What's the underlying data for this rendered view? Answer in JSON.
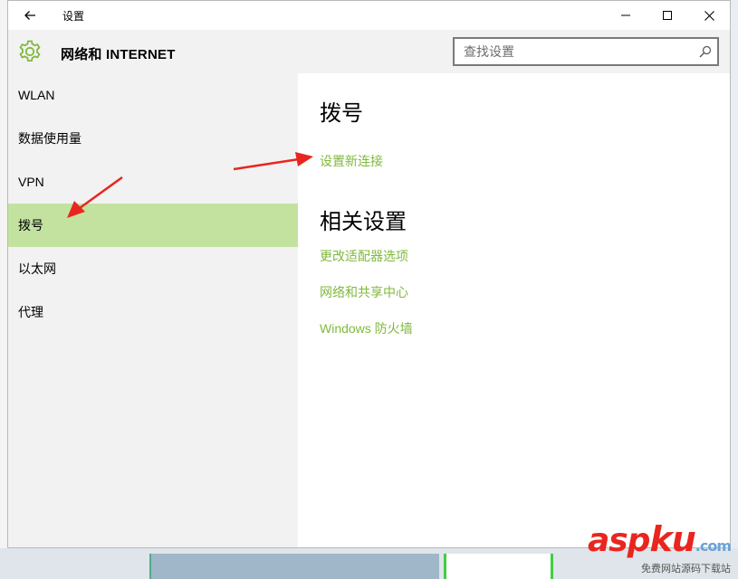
{
  "window": {
    "title": "设置",
    "icons": {
      "back": "back-arrow-icon",
      "minimize": "minimize-icon",
      "maximize": "maximize-icon",
      "close": "close-icon"
    }
  },
  "header": {
    "icon": "gear-icon",
    "title": "网络和 INTERNET",
    "search_placeholder": "查找设置",
    "search_value": "",
    "search_icon": "search-icon",
    "accent_color": "#80b93c"
  },
  "sidebar": {
    "items": [
      {
        "label": "WLAN",
        "selected": false
      },
      {
        "label": "数据使用量",
        "selected": false
      },
      {
        "label": "VPN",
        "selected": false
      },
      {
        "label": "拨号",
        "selected": true
      },
      {
        "label": "以太网",
        "selected": false
      },
      {
        "label": "代理",
        "selected": false
      }
    ],
    "selected_color": "#c3e2a0"
  },
  "content": {
    "heading": "拨号",
    "new_connection_link": "设置新连接",
    "related_heading": "相关设置",
    "related_links": [
      "更改适配器选项",
      "网络和共享中心",
      "Windows 防火墙"
    ]
  },
  "watermark": {
    "logo_main": "asp",
    "logo_ku": "ku",
    "logo_com": ".com",
    "subtitle": "免费网站源码下载站"
  }
}
